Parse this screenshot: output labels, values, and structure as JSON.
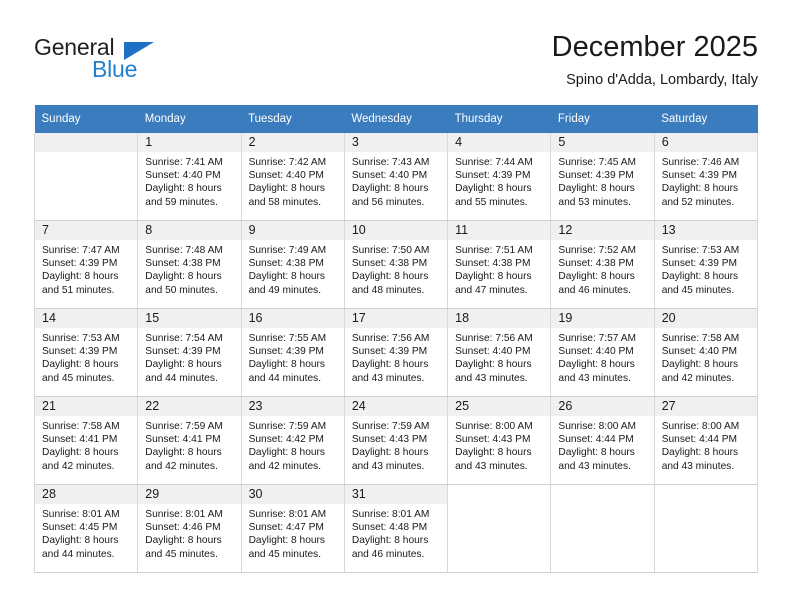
{
  "brand": {
    "name_part1": "General",
    "name_part2": "Blue",
    "color_dark": "#231f20",
    "color_blue": "#2480cb"
  },
  "header": {
    "title": "December 2025",
    "subtitle": "Spino d'Adda, Lombardy, Italy"
  },
  "theme": {
    "header_band": "#3a7cbe",
    "daynum_background": "#f0f0f0",
    "grid_border": "#d8d8d8"
  },
  "weekday_headers": [
    "Sunday",
    "Monday",
    "Tuesday",
    "Wednesday",
    "Thursday",
    "Friday",
    "Saturday"
  ],
  "weeks": [
    [
      {
        "day": "",
        "sunrise": "",
        "sunset": "",
        "daylight1": "",
        "daylight2": ""
      },
      {
        "day": "1",
        "sunrise": "Sunrise: 7:41 AM",
        "sunset": "Sunset: 4:40 PM",
        "daylight1": "Daylight: 8 hours",
        "daylight2": "and 59 minutes."
      },
      {
        "day": "2",
        "sunrise": "Sunrise: 7:42 AM",
        "sunset": "Sunset: 4:40 PM",
        "daylight1": "Daylight: 8 hours",
        "daylight2": "and 58 minutes."
      },
      {
        "day": "3",
        "sunrise": "Sunrise: 7:43 AM",
        "sunset": "Sunset: 4:40 PM",
        "daylight1": "Daylight: 8 hours",
        "daylight2": "and 56 minutes."
      },
      {
        "day": "4",
        "sunrise": "Sunrise: 7:44 AM",
        "sunset": "Sunset: 4:39 PM",
        "daylight1": "Daylight: 8 hours",
        "daylight2": "and 55 minutes."
      },
      {
        "day": "5",
        "sunrise": "Sunrise: 7:45 AM",
        "sunset": "Sunset: 4:39 PM",
        "daylight1": "Daylight: 8 hours",
        "daylight2": "and 53 minutes."
      },
      {
        "day": "6",
        "sunrise": "Sunrise: 7:46 AM",
        "sunset": "Sunset: 4:39 PM",
        "daylight1": "Daylight: 8 hours",
        "daylight2": "and 52 minutes."
      }
    ],
    [
      {
        "day": "7",
        "sunrise": "Sunrise: 7:47 AM",
        "sunset": "Sunset: 4:39 PM",
        "daylight1": "Daylight: 8 hours",
        "daylight2": "and 51 minutes."
      },
      {
        "day": "8",
        "sunrise": "Sunrise: 7:48 AM",
        "sunset": "Sunset: 4:38 PM",
        "daylight1": "Daylight: 8 hours",
        "daylight2": "and 50 minutes."
      },
      {
        "day": "9",
        "sunrise": "Sunrise: 7:49 AM",
        "sunset": "Sunset: 4:38 PM",
        "daylight1": "Daylight: 8 hours",
        "daylight2": "and 49 minutes."
      },
      {
        "day": "10",
        "sunrise": "Sunrise: 7:50 AM",
        "sunset": "Sunset: 4:38 PM",
        "daylight1": "Daylight: 8 hours",
        "daylight2": "and 48 minutes."
      },
      {
        "day": "11",
        "sunrise": "Sunrise: 7:51 AM",
        "sunset": "Sunset: 4:38 PM",
        "daylight1": "Daylight: 8 hours",
        "daylight2": "and 47 minutes."
      },
      {
        "day": "12",
        "sunrise": "Sunrise: 7:52 AM",
        "sunset": "Sunset: 4:38 PM",
        "daylight1": "Daylight: 8 hours",
        "daylight2": "and 46 minutes."
      },
      {
        "day": "13",
        "sunrise": "Sunrise: 7:53 AM",
        "sunset": "Sunset: 4:39 PM",
        "daylight1": "Daylight: 8 hours",
        "daylight2": "and 45 minutes."
      }
    ],
    [
      {
        "day": "14",
        "sunrise": "Sunrise: 7:53 AM",
        "sunset": "Sunset: 4:39 PM",
        "daylight1": "Daylight: 8 hours",
        "daylight2": "and 45 minutes."
      },
      {
        "day": "15",
        "sunrise": "Sunrise: 7:54 AM",
        "sunset": "Sunset: 4:39 PM",
        "daylight1": "Daylight: 8 hours",
        "daylight2": "and 44 minutes."
      },
      {
        "day": "16",
        "sunrise": "Sunrise: 7:55 AM",
        "sunset": "Sunset: 4:39 PM",
        "daylight1": "Daylight: 8 hours",
        "daylight2": "and 44 minutes."
      },
      {
        "day": "17",
        "sunrise": "Sunrise: 7:56 AM",
        "sunset": "Sunset: 4:39 PM",
        "daylight1": "Daylight: 8 hours",
        "daylight2": "and 43 minutes."
      },
      {
        "day": "18",
        "sunrise": "Sunrise: 7:56 AM",
        "sunset": "Sunset: 4:40 PM",
        "daylight1": "Daylight: 8 hours",
        "daylight2": "and 43 minutes."
      },
      {
        "day": "19",
        "sunrise": "Sunrise: 7:57 AM",
        "sunset": "Sunset: 4:40 PM",
        "daylight1": "Daylight: 8 hours",
        "daylight2": "and 43 minutes."
      },
      {
        "day": "20",
        "sunrise": "Sunrise: 7:58 AM",
        "sunset": "Sunset: 4:40 PM",
        "daylight1": "Daylight: 8 hours",
        "daylight2": "and 42 minutes."
      }
    ],
    [
      {
        "day": "21",
        "sunrise": "Sunrise: 7:58 AM",
        "sunset": "Sunset: 4:41 PM",
        "daylight1": "Daylight: 8 hours",
        "daylight2": "and 42 minutes."
      },
      {
        "day": "22",
        "sunrise": "Sunrise: 7:59 AM",
        "sunset": "Sunset: 4:41 PM",
        "daylight1": "Daylight: 8 hours",
        "daylight2": "and 42 minutes."
      },
      {
        "day": "23",
        "sunrise": "Sunrise: 7:59 AM",
        "sunset": "Sunset: 4:42 PM",
        "daylight1": "Daylight: 8 hours",
        "daylight2": "and 42 minutes."
      },
      {
        "day": "24",
        "sunrise": "Sunrise: 7:59 AM",
        "sunset": "Sunset: 4:43 PM",
        "daylight1": "Daylight: 8 hours",
        "daylight2": "and 43 minutes."
      },
      {
        "day": "25",
        "sunrise": "Sunrise: 8:00 AM",
        "sunset": "Sunset: 4:43 PM",
        "daylight1": "Daylight: 8 hours",
        "daylight2": "and 43 minutes."
      },
      {
        "day": "26",
        "sunrise": "Sunrise: 8:00 AM",
        "sunset": "Sunset: 4:44 PM",
        "daylight1": "Daylight: 8 hours",
        "daylight2": "and 43 minutes."
      },
      {
        "day": "27",
        "sunrise": "Sunrise: 8:00 AM",
        "sunset": "Sunset: 4:44 PM",
        "daylight1": "Daylight: 8 hours",
        "daylight2": "and 43 minutes."
      }
    ],
    [
      {
        "day": "28",
        "sunrise": "Sunrise: 8:01 AM",
        "sunset": "Sunset: 4:45 PM",
        "daylight1": "Daylight: 8 hours",
        "daylight2": "and 44 minutes."
      },
      {
        "day": "29",
        "sunrise": "Sunrise: 8:01 AM",
        "sunset": "Sunset: 4:46 PM",
        "daylight1": "Daylight: 8 hours",
        "daylight2": "and 45 minutes."
      },
      {
        "day": "30",
        "sunrise": "Sunrise: 8:01 AM",
        "sunset": "Sunset: 4:47 PM",
        "daylight1": "Daylight: 8 hours",
        "daylight2": "and 45 minutes."
      },
      {
        "day": "31",
        "sunrise": "Sunrise: 8:01 AM",
        "sunset": "Sunset: 4:48 PM",
        "daylight1": "Daylight: 8 hours",
        "daylight2": "and 46 minutes."
      },
      {
        "day": "",
        "sunrise": "",
        "sunset": "",
        "daylight1": "",
        "daylight2": ""
      },
      {
        "day": "",
        "sunrise": "",
        "sunset": "",
        "daylight1": "",
        "daylight2": ""
      },
      {
        "day": "",
        "sunrise": "",
        "sunset": "",
        "daylight1": "",
        "daylight2": ""
      }
    ]
  ]
}
